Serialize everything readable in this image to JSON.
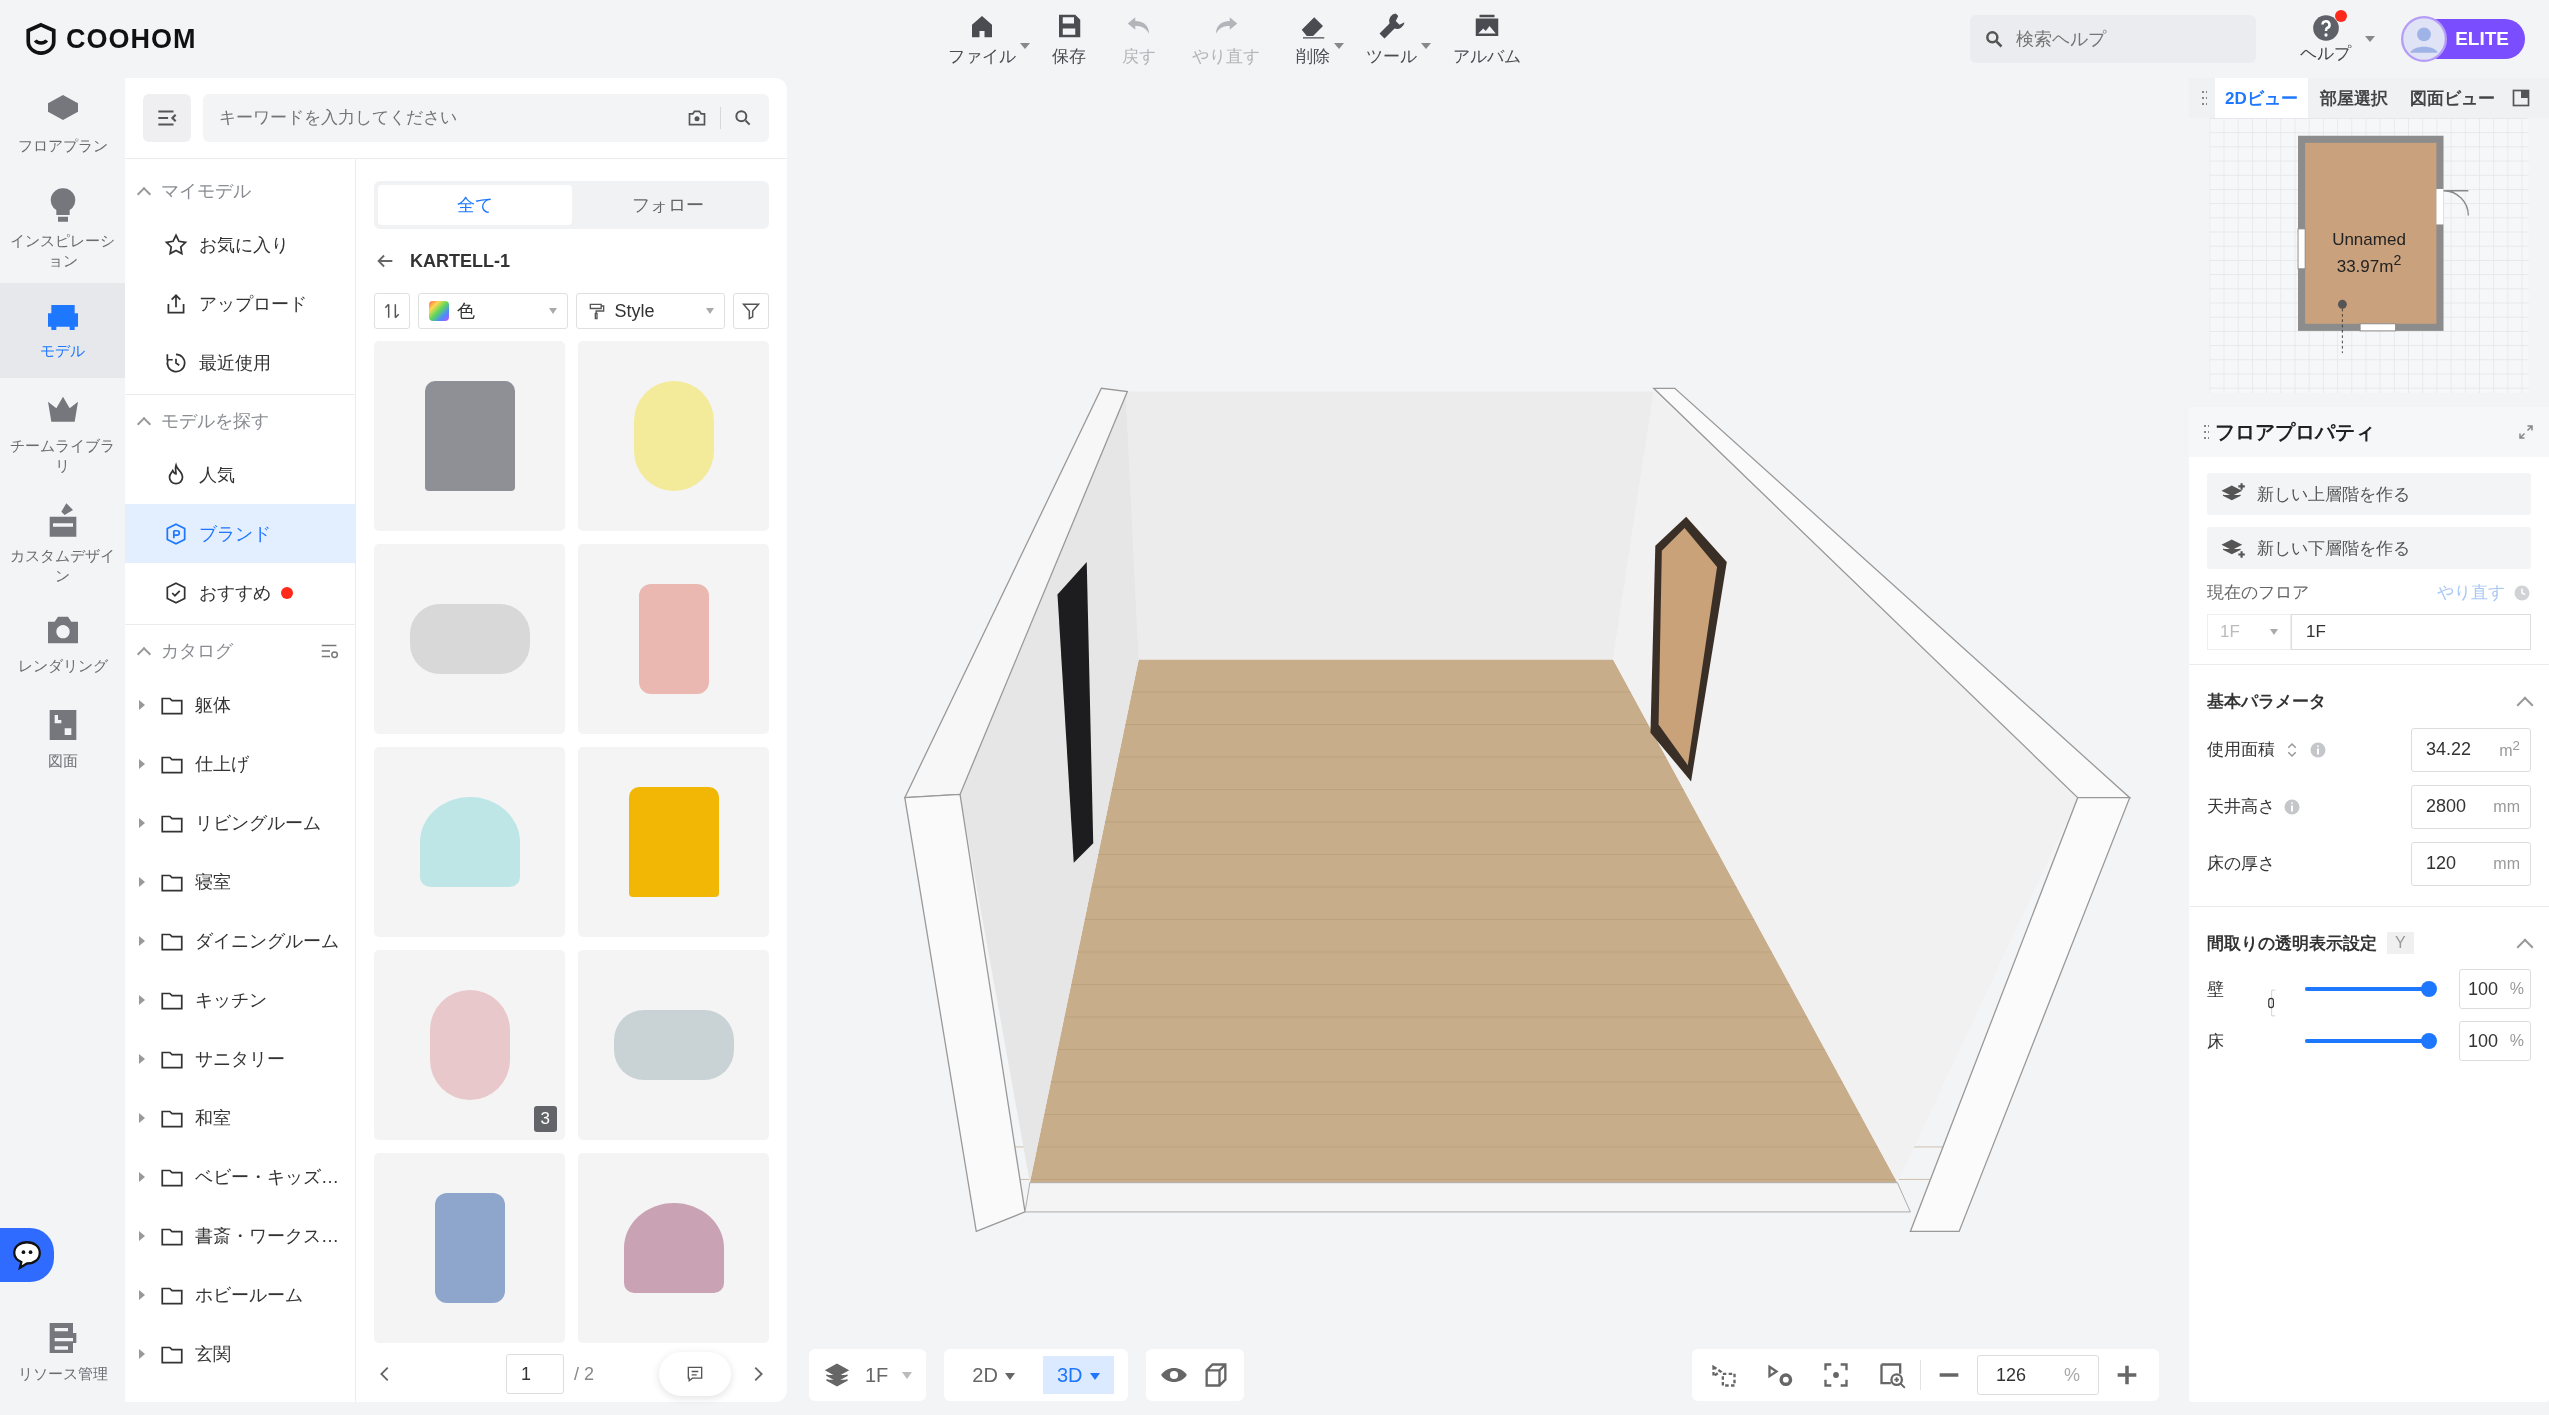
{
  "header": {
    "logo": "COOHOM",
    "search": {
      "placeholder": "検索ヘルプ"
    },
    "help": {
      "label": "ヘルプ",
      "notification": true
    },
    "plan": "ELITE"
  },
  "toolbar": [
    {
      "label": "ファイル",
      "disabled": false,
      "menu": true
    },
    {
      "label": "保存",
      "disabled": false,
      "menu": false
    },
    {
      "label": "戻す",
      "disabled": true,
      "menu": false
    },
    {
      "label": "やり直す",
      "disabled": true,
      "menu": false
    },
    {
      "label": "削除",
      "disabled": false,
      "menu": true
    },
    {
      "label": "ツール",
      "disabled": false,
      "menu": true
    },
    {
      "label": "アルバム",
      "disabled": false,
      "menu": false
    }
  ],
  "rail": {
    "items": [
      {
        "label": "フロアプラン",
        "selected": false
      },
      {
        "label": "インスピレーション",
        "selected": false
      },
      {
        "label": "モデル",
        "selected": true
      },
      {
        "label": "チームライブラリ",
        "selected": false
      },
      {
        "label": "カスタムデザイン",
        "selected": false
      },
      {
        "label": "レンダリング",
        "selected": false
      },
      {
        "label": "図面",
        "selected": false
      }
    ],
    "footer": "リソース管理"
  },
  "model_panel": {
    "search": {
      "placeholder": "キーワードを入力してください"
    },
    "sections": [
      {
        "title": "マイモデル",
        "expanded": true,
        "items": [
          {
            "label": "お気に入り",
            "selected": false,
            "new": false
          },
          {
            "label": "アップロード",
            "selected": false,
            "new": false
          },
          {
            "label": "最近使用",
            "selected": false,
            "new": false
          }
        ]
      },
      {
        "title": "モデルを探す",
        "expanded": true,
        "items": [
          {
            "label": "人気",
            "selected": false,
            "new": false
          },
          {
            "label": "ブランド",
            "selected": true,
            "new": false
          },
          {
            "label": "おすすめ",
            "selected": false,
            "new": true
          }
        ]
      }
    ],
    "catalog": {
      "title": "カタログ",
      "expanded": true,
      "items": [
        {
          "label": "躯体",
          "expanded": false
        },
        {
          "label": "仕上げ",
          "expanded": false
        },
        {
          "label": "リビングルーム",
          "expanded": false
        },
        {
          "label": "寝室",
          "expanded": false
        },
        {
          "label": "ダイニングルーム",
          "expanded": false
        },
        {
          "label": "キッチン",
          "expanded": false
        },
        {
          "label": "サニタリー",
          "expanded": false
        },
        {
          "label": "和室",
          "expanded": false
        },
        {
          "label": "ベビー・キッズ…",
          "expanded": false
        },
        {
          "label": "書斎・ワークス…",
          "expanded": false
        },
        {
          "label": "ホビールーム",
          "expanded": false
        },
        {
          "label": "玄関",
          "expanded": false
        }
      ]
    },
    "tabs": [
      {
        "label": "全て",
        "selected": true
      },
      {
        "label": "フォロー",
        "selected": false
      }
    ],
    "breadcrumb": "KARTELL-1",
    "filters": {
      "color_filter": "色",
      "style_filter": "Style"
    },
    "products": [
      {
        "color": "#8f9096"
      },
      {
        "color": "#f3ea9a"
      },
      {
        "color": "#d8d8d8"
      },
      {
        "color": "#eab8b0"
      },
      {
        "color": "#bfe6e6"
      },
      {
        "color": "#f2b705"
      },
      {
        "color": "#e9c8cc",
        "variants": "3"
      },
      {
        "color": "#c9d3d6"
      },
      {
        "color": "#8ea6cc"
      },
      {
        "color": "#c9a3b4"
      }
    ],
    "pagination": {
      "page": "1",
      "total": "/ 2"
    }
  },
  "viewport": {
    "floor": "1F",
    "view_modes": [
      {
        "label": "2D",
        "selected": false
      },
      {
        "label": "3D",
        "selected": true
      }
    ],
    "zoom": {
      "value": "126",
      "unit": "%"
    }
  },
  "right_panel": {
    "tabs": [
      {
        "label": "2Dビュー",
        "selected": true
      },
      {
        "label": "部屋選択",
        "selected": false
      },
      {
        "label": "図面ビュー",
        "selected": false
      }
    ],
    "minimap": {
      "room": "Unnamed",
      "area": "33.97m$^{2}$"
    },
    "properties": {
      "title": "フロアプロパティ",
      "actions": [
        "新しい上層階を作る",
        "新しい下層階を作る"
      ],
      "current_floor": {
        "label": "現在のフロア",
        "redo": "やり直す",
        "select": "1F",
        "value": "1F"
      },
      "basic": {
        "title": "基本パラメータ",
        "expanded": true,
        "fields": [
          {
            "label": "使用面積",
            "sortable": true,
            "info": true,
            "value": "34.22",
            "unit": "m$^{2}$"
          },
          {
            "label": "天井高さ",
            "sortable": false,
            "info": true,
            "value": "2800",
            "unit": "mm"
          },
          {
            "label": "床の厚さ",
            "sortable": false,
            "info": false,
            "value": "120",
            "unit": "mm"
          }
        ]
      },
      "transparency": {
        "title": "間取りの透明表示設定",
        "badge": "Y",
        "expanded": true,
        "sliders": [
          {
            "label": "壁",
            "level": 1,
            "value": "100",
            "unit": "%"
          },
          {
            "label": "床",
            "level": 1,
            "value": "100",
            "unit": "%"
          }
        ]
      }
    }
  }
}
